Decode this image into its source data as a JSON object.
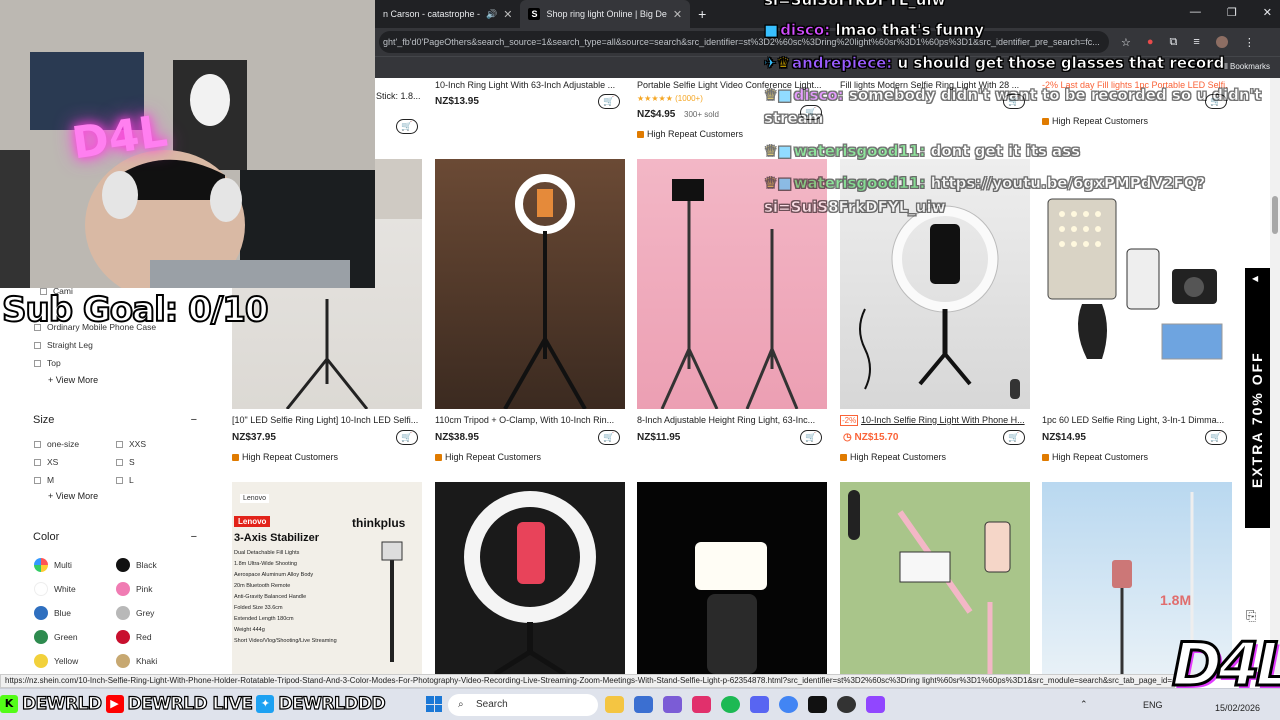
{
  "browser": {
    "tabs": [
      {
        "label": "n Carson - catastrophe -",
        "active": false
      },
      {
        "label": "Shop ring light Online | Big De",
        "active": true
      }
    ],
    "url": "ght'_fb'd0'PageOthers&search_source=1&search_type=all&source=search&src_identifier=st%3D2%60sc%3Dring%20light%60sr%3D1%60ps%3D1&src_identifier_pre_search=fc...",
    "all_bookmarks": "All Bookmarks",
    "tab_favicon": "S",
    "new_tab": "+"
  },
  "filters": {
    "categories": [
      "Cami",
      "Ordinary Mobile Phone Case",
      "Straight Leg",
      "Top"
    ],
    "view_more": "+ View More",
    "size_title": "Size",
    "sizes": [
      "one-size",
      "XXS",
      "XS",
      "S",
      "M",
      "L"
    ],
    "color_title": "Color",
    "collapse": "−",
    "colors": [
      {
        "name": "Multi",
        "hex": "multi"
      },
      {
        "name": "Black",
        "hex": "#111111"
      },
      {
        "name": "White",
        "hex": "#ffffff"
      },
      {
        "name": "Pink",
        "hex": "#f07cb3"
      },
      {
        "name": "Blue",
        "hex": "#2f6fbf"
      },
      {
        "name": "Grey",
        "hex": "#b8b8b8"
      },
      {
        "name": "Green",
        "hex": "#2e8b4f"
      },
      {
        "name": "Red",
        "hex": "#c8102e"
      },
      {
        "name": "Yellow",
        "hex": "#f2d13b"
      },
      {
        "name": "Khaki",
        "hex": "#c7a871"
      }
    ]
  },
  "top_row": {
    "items": [
      {
        "name": "Stick: 1.8...",
        "price": ""
      },
      {
        "name": "10-Inch Ring Light With 63-Inch Adjustable ...",
        "price": "NZ$13.95"
      },
      {
        "name": "Portable Selfie Light Video Conference Light...",
        "rating": "★★★★★ (1000+)",
        "price": "NZ$4.95",
        "sold": "300+ sold",
        "tag": "High Repeat Customers"
      },
      {
        "name": "Fill lights Modern Selfie Ring Light With 28 ...",
        "price": ""
      },
      {
        "name": "-2% Last day  Fill lights 1pc Portable LED Selfi...",
        "tag": "High Repeat Customers"
      }
    ]
  },
  "products": [
    {
      "name": "[10\" LED Selfie Ring Light] 10-Inch LED Selfi...",
      "price": "NZ$37.95",
      "tag": "High Repeat Customers"
    },
    {
      "name": "110cm Tripod + O-Clamp, With 10-Inch Rin...",
      "price": "NZ$38.95",
      "tag": "High Repeat Customers"
    },
    {
      "name": "8-Inch Adjustable Height Ring Light, 63-Inc...",
      "price": "NZ$11.95",
      "tag": ""
    },
    {
      "name": "10-Inch Selfie Ring Light With Phone H...",
      "price": "NZ$15.70",
      "discount": "-2%",
      "tag": "High Repeat Customers"
    },
    {
      "name": "1pc 60 LED Selfie Ring Light, 3-In-1 Dimma...",
      "price": "NZ$14.95",
      "tag": "High Repeat Customers"
    }
  ],
  "bottom_row": {
    "stabilizer": {
      "brand": "Lenovo",
      "brand2": "thinkplus",
      "title": "3-Axis Stabilizer",
      "features": [
        "Dual Detachable Fill Lights",
        "1.8m Ultra-Wide Shooting",
        "Aerospace Aluminum Alloy Body",
        "20m Bluetooth Remote",
        "Anti-Gravity Balanced Handle",
        "Folded Size 33.6cm",
        "Extended Length 180cm",
        "Weight 444g",
        "Short Video/Vlog/Shooting/Live Streaming"
      ]
    },
    "height_label": "1.8M"
  },
  "side_banner": "EXTRA 70% OFF",
  "status_url": "https://nz.shein.com/10-Inch-Selfie-Ring-Light-With-Phone-Holder-Rotatable-Tripod-Stand-And-3-Color-Modes-For-Photography-Video-Recording-Live-Streaming-Zoom-Meetings-With-Stand-Selfie-Light-p-62354878.html?src_identifier=st%3D2%60sc%3Dring light%60sr%3D1%60ps%3D1&src_module=search&src_tab_page_id=...",
  "taskbar": {
    "search": "Search",
    "lang": "ENG",
    "time": "15/02/2026"
  },
  "stream": {
    "sub_goal": "Sub Goal: 0/10",
    "neon_sign": "D4L",
    "logo": "D4L",
    "socials": [
      "DEWRLD",
      "DEWRLD LIVE",
      "DEWRLDDD"
    ],
    "chat": [
      {
        "user": "",
        "text": "si=SuiS8FrkDFYL_uiw",
        "color": "#ffffff"
      },
      {
        "user": "disco:",
        "text": "lmao that's funny",
        "color": "#d24dff"
      },
      {
        "user": "andrepiece:",
        "text": "u should get those glasses that record",
        "color": "#9b5cff"
      },
      {
        "user": "disco:",
        "text": "somebody didn't want to be recorded so u didn't",
        "color": "#d24dff"
      },
      {
        "user": "",
        "text": "stream",
        "color": "#ffffff"
      },
      {
        "user": "waterisgood11:",
        "text": "dont get it its ass",
        "color": "#32d24b"
      },
      {
        "user": "waterisgood11:",
        "text": "https://youtu.be/6gxPMPdV2FQ?",
        "color": "#32d24b"
      },
      {
        "user": "",
        "text": "si=SuiS8FrkDFYL_uiw",
        "color": "#ffffff"
      }
    ]
  },
  "colors": {
    "accent_orange": "#e07b00",
    "discount_red": "#fa6338",
    "chrome_dark": "#202124"
  }
}
